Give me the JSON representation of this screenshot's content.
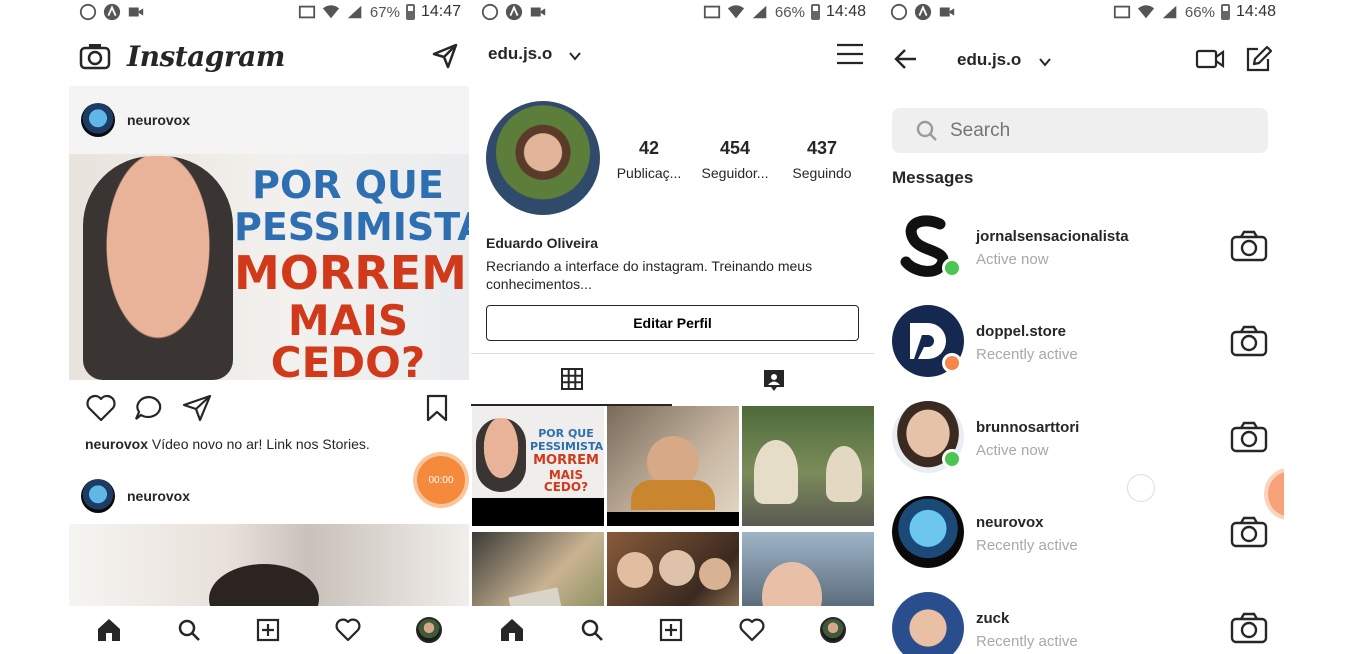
{
  "phone1": {
    "status": {
      "battery": "67%",
      "time": "14:47"
    },
    "app_title": "Instagram",
    "post1": {
      "username": "neurovox",
      "headline": [
        "POR QUE",
        "PESSIMISTAS",
        "MORREM",
        "MAIS CEDO?"
      ],
      "caption_user": "neurovox",
      "caption_text": " Vídeo novo no ar! Link nos Stories."
    },
    "post2": {
      "username": "neurovox"
    },
    "timer": "00:00"
  },
  "phone2": {
    "status": {
      "battery": "66%",
      "time": "14:48"
    },
    "username": "edu.js.o",
    "stats": [
      {
        "num": "42",
        "label": "Publicaç..."
      },
      {
        "num": "454",
        "label": "Seguidor..."
      },
      {
        "num": "437",
        "label": "Seguindo"
      }
    ],
    "bio_name": "Eduardo Oliveira",
    "bio_text": "Recriando a interface do instagram. Treinando meus conhecimentos...",
    "edit_button": "Editar Perfil",
    "thumb_headline": [
      "POR QUE",
      "PESSIMISTAS",
      "MORREM",
      "MAIS CEDO?"
    ]
  },
  "phone3": {
    "status": {
      "battery": "66%",
      "time": "14:48"
    },
    "username": "edu.js.o",
    "search_placeholder": "Search",
    "messages_title": "Messages",
    "messages": [
      {
        "name": "jornalsensacionalista",
        "status": "Active now",
        "dot": "#4cc552"
      },
      {
        "name": "doppel.store",
        "status": "Recently active",
        "dot": "#f5874b"
      },
      {
        "name": "brunnosarttori",
        "status": "Active now",
        "dot": "#4cc552"
      },
      {
        "name": "neurovox",
        "status": "Recently active",
        "dot": ""
      },
      {
        "name": "zuck",
        "status": "Recently active",
        "dot": ""
      }
    ]
  }
}
